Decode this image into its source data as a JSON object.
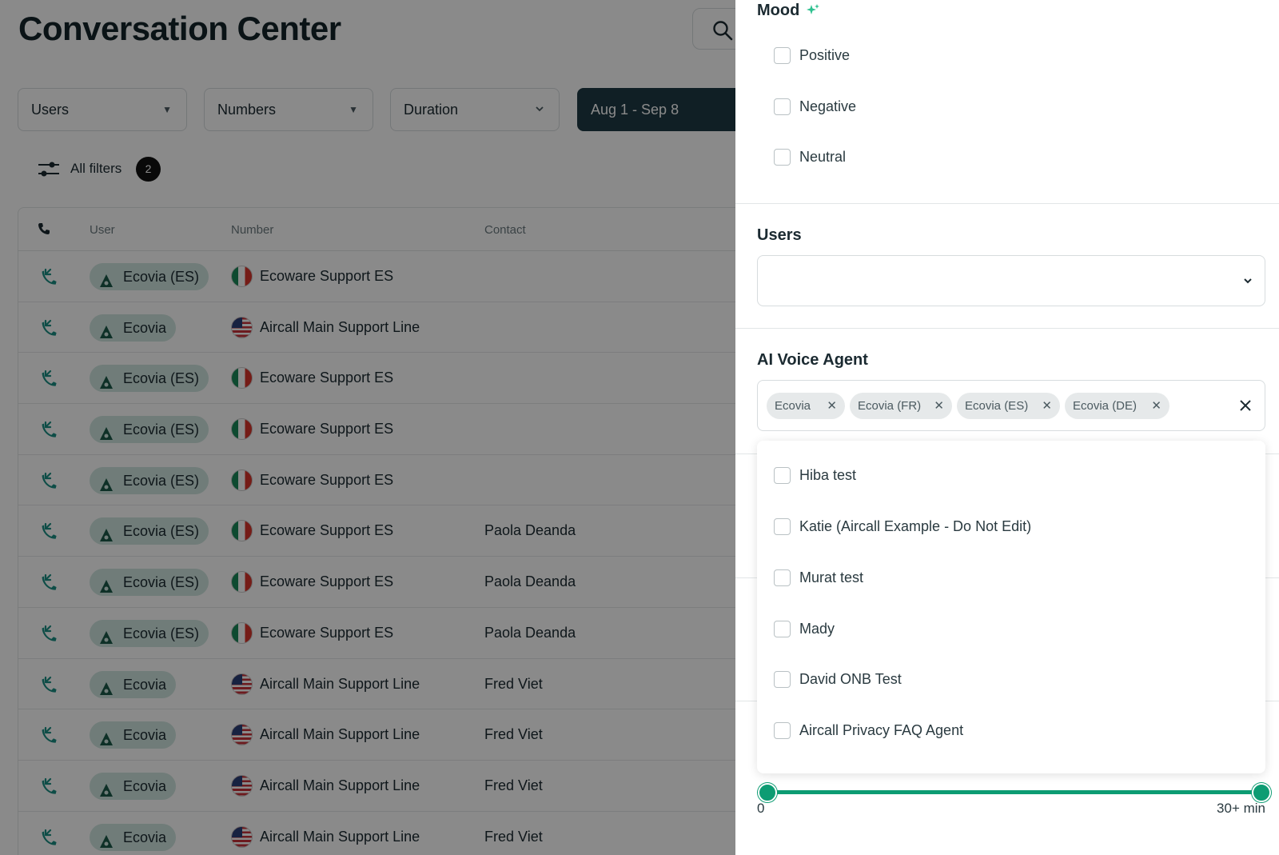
{
  "page": {
    "title": "Conversation Center",
    "filters": {
      "users_label": "Users",
      "numbers_label": "Numbers",
      "duration_label": "Duration",
      "date_label": "Aug 1 - Sep 8",
      "all_filters_label": "All filters",
      "all_filters_count": "2"
    },
    "table": {
      "columns": {
        "user": "User",
        "number": "Number",
        "contact": "Contact"
      },
      "rows": [
        {
          "user": "Ecovia (ES)",
          "flag": "es",
          "number": "Ecoware Support ES",
          "contact": ""
        },
        {
          "user": "Ecovia",
          "flag": "us",
          "number": "Aircall Main Support Line",
          "contact": ""
        },
        {
          "user": "Ecovia (ES)",
          "flag": "es",
          "number": "Ecoware Support ES",
          "contact": ""
        },
        {
          "user": "Ecovia (ES)",
          "flag": "es",
          "number": "Ecoware Support ES",
          "contact": ""
        },
        {
          "user": "Ecovia (ES)",
          "flag": "es",
          "number": "Ecoware Support ES",
          "contact": ""
        },
        {
          "user": "Ecovia (ES)",
          "flag": "es",
          "number": "Ecoware Support ES",
          "contact": "Paola Deanda"
        },
        {
          "user": "Ecovia (ES)",
          "flag": "es",
          "number": "Ecoware Support ES",
          "contact": "Paola Deanda"
        },
        {
          "user": "Ecovia (ES)",
          "flag": "es",
          "number": "Ecoware Support ES",
          "contact": "Paola Deanda"
        },
        {
          "user": "Ecovia",
          "flag": "us",
          "number": "Aircall Main Support Line",
          "contact": "Fred Viet"
        },
        {
          "user": "Ecovia",
          "flag": "us",
          "number": "Aircall Main Support Line",
          "contact": "Fred Viet"
        },
        {
          "user": "Ecovia",
          "flag": "us",
          "number": "Aircall Main Support Line",
          "contact": "Fred Viet"
        },
        {
          "user": "Ecovia",
          "flag": "us",
          "number": "Aircall Main Support Line",
          "contact": "Fred Viet"
        }
      ]
    }
  },
  "drawer": {
    "mood": {
      "title": "Mood",
      "options": [
        "Positive",
        "Negative",
        "Neutral"
      ]
    },
    "users": {
      "title": "Users"
    },
    "ai_voice_agent": {
      "title": "AI Voice Agent",
      "selected": [
        "Ecovia",
        "Ecovia (FR)",
        "Ecovia (ES)",
        "Ecovia (DE)"
      ],
      "options": [
        "Hiba test",
        "Katie (Aircall Example - Do Not Edit)",
        "Murat test",
        "Mady",
        "David ONB Test",
        "Aircall Privacy FAQ Agent"
      ]
    },
    "duration_slider": {
      "min_label": "0",
      "max_label": "30+ min",
      "range_fraction": [
        0,
        1
      ]
    }
  },
  "colors": {
    "accent": "#0d9c73",
    "date_button": "#1f3a45",
    "user_chip": "#cfe6df",
    "overlay": "rgba(0,0,0,0.46)"
  }
}
